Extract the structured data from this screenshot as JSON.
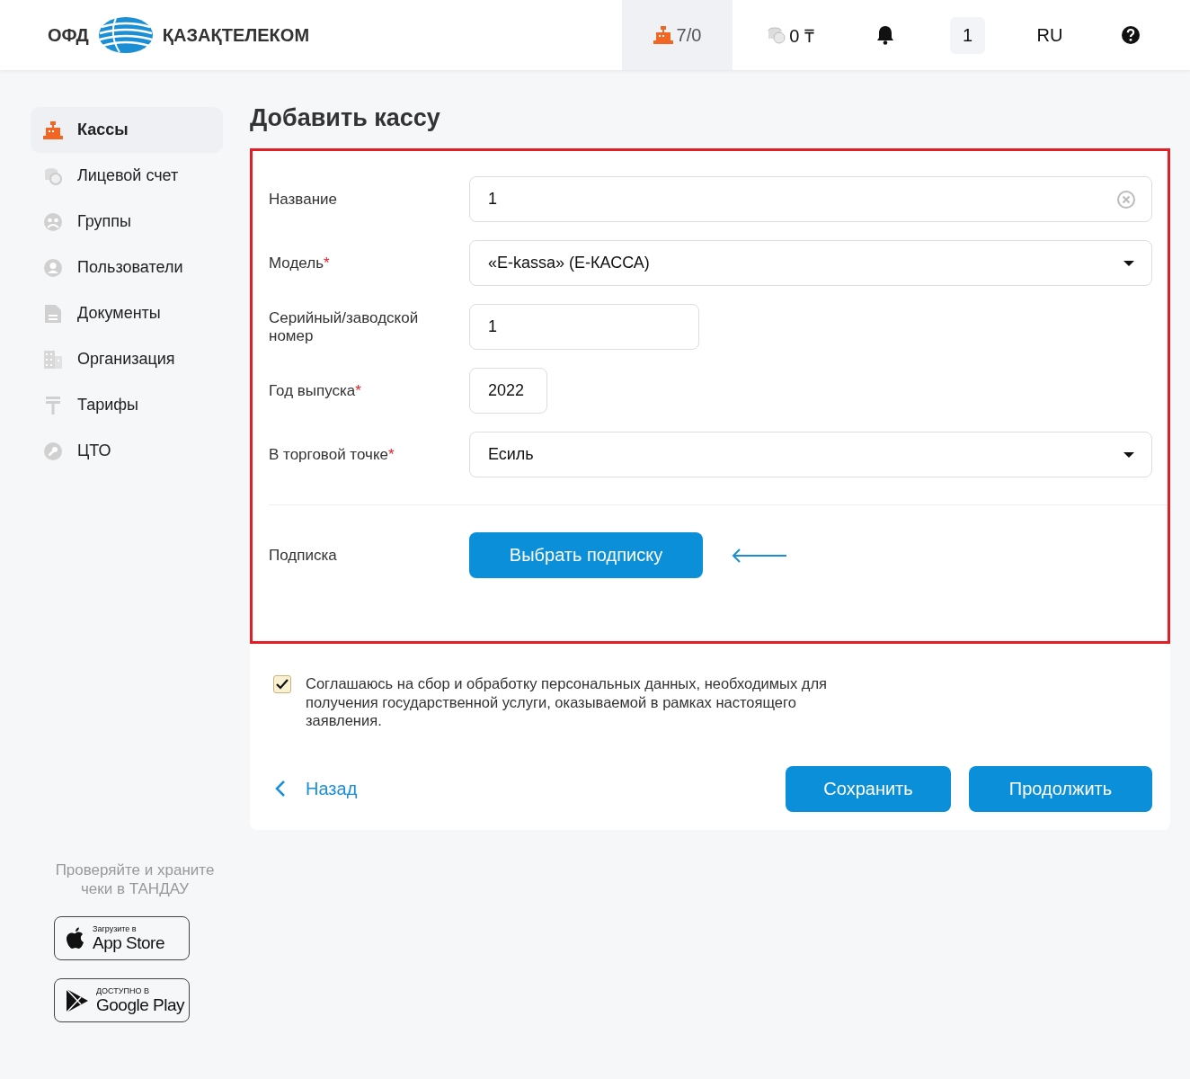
{
  "header": {
    "logo_left": "ОФД",
    "logo_right": "ҚАЗАҚТЕЛЕКОМ",
    "register_count": "7/0",
    "balance": "0 ₸",
    "counter": "1",
    "language": "RU"
  },
  "sidebar": {
    "items": [
      {
        "label": "Кассы",
        "selected": true
      },
      {
        "label": "Лицевой счет",
        "selected": false
      },
      {
        "label": "Группы",
        "selected": false
      },
      {
        "label": "Пользователи",
        "selected": false
      },
      {
        "label": "Документы",
        "selected": false
      },
      {
        "label": "Организация",
        "selected": false
      },
      {
        "label": "Тарифы",
        "selected": false
      },
      {
        "label": "ЦТО",
        "selected": false
      }
    ],
    "promo": "Проверяйте и храните чеки в ТАНДАУ",
    "stores": [
      {
        "kind": "apple",
        "small": "Загрузите в",
        "big": "App Store"
      },
      {
        "kind": "google",
        "small": "ДОСТУПНО В",
        "big": "Google Play"
      }
    ]
  },
  "form": {
    "title": "Добавить кассу",
    "required_mark": "*",
    "fields": [
      {
        "kind": "text",
        "label": "Название",
        "required": false,
        "value": "1",
        "clearable": true
      },
      {
        "kind": "select",
        "label": "Модель",
        "required": true,
        "value": "«E-kassa» (E-КАССА)"
      },
      {
        "kind": "text",
        "label": "Серийный/заводской номер",
        "required": false,
        "value": "1",
        "clearable": false
      },
      {
        "kind": "text",
        "label": "Год выпуска",
        "required": true,
        "value": "2022",
        "clearable": false
      },
      {
        "kind": "select",
        "label": "В торговой точке",
        "required": true,
        "value": "Есиль"
      }
    ],
    "subscription": {
      "label": "Подписка",
      "button": "Выбрать подписку"
    },
    "consent": {
      "checked": true,
      "text": "Соглашаюсь на сбор и обработку персональных данных, необходимых для получения государственной услуги, оказываемой в рамках настоящего заявления."
    },
    "back": "Назад",
    "buttons": [
      "Сохранить",
      "Продолжить"
    ]
  }
}
